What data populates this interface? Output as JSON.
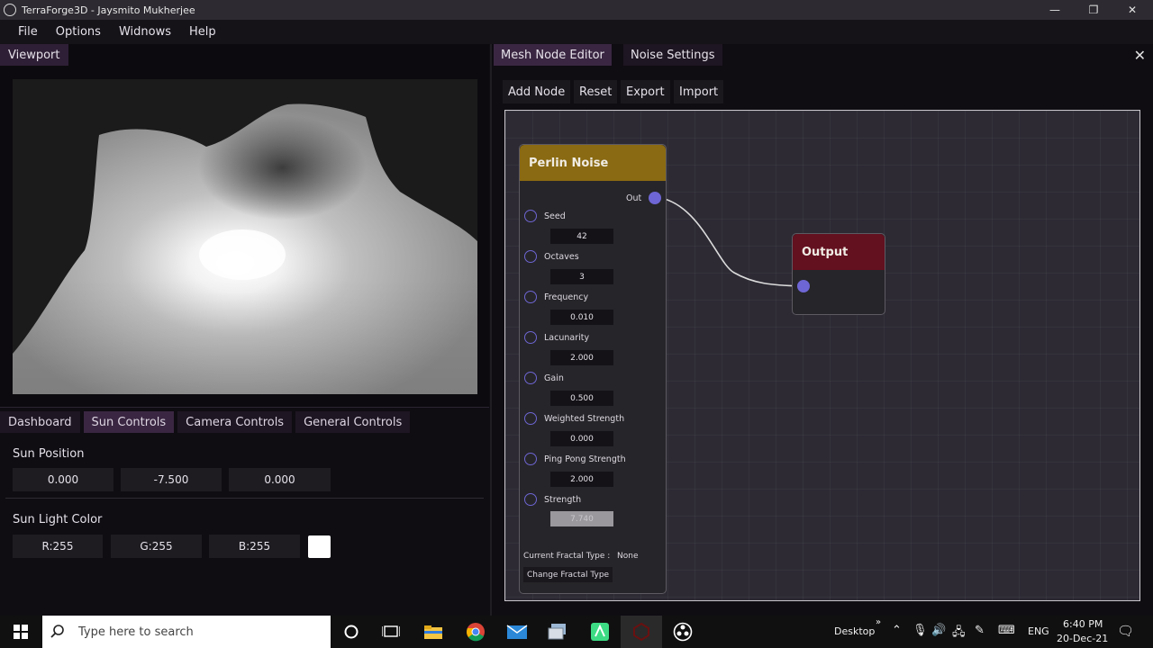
{
  "window": {
    "title": "TerraForge3D - Jaysmito Mukherjee"
  },
  "menu": [
    "File",
    "Options",
    "Widnows",
    "Help"
  ],
  "viewport": {
    "tab": "Viewport"
  },
  "controls": {
    "tabs": [
      "Dashboard",
      "Sun Controls",
      "Camera Controls",
      "General Controls"
    ],
    "sun_position": {
      "label": "Sun Position",
      "values": [
        "0.000",
        "-7.500",
        "0.000"
      ]
    },
    "sun_light_color": {
      "label": "Sun Light Color",
      "r": "R:255",
      "g": "G:255",
      "b": "B:255",
      "swatch": "#ffffff"
    }
  },
  "node_editor": {
    "tabs": [
      "Mesh Node Editor",
      "Noise Settings"
    ],
    "toolbar": [
      "Add Node",
      "Reset",
      "Export",
      "Import"
    ],
    "perlin_node": {
      "title": "Perlin Noise",
      "output_label": "Out",
      "params": [
        {
          "label": "Seed",
          "value": "42"
        },
        {
          "label": "Octaves",
          "value": "3"
        },
        {
          "label": "Frequency",
          "value": "0.010"
        },
        {
          "label": "Lacunarity",
          "value": "2.000"
        },
        {
          "label": "Gain",
          "value": "0.500"
        },
        {
          "label": "Weighted Strength",
          "value": "0.000"
        },
        {
          "label": "Ping Pong Strength",
          "value": "2.000"
        },
        {
          "label": "Strength",
          "value": "7.740"
        }
      ],
      "fractal_label": "Current Fractal Type :",
      "fractal_value": "None",
      "change_fractal": "Change Fractal Type"
    },
    "output_node": {
      "title": "Output"
    }
  },
  "taskbar": {
    "search_placeholder": "Type here to search",
    "desktop_label": "Desktop",
    "language": "ENG",
    "time": "6:40 PM",
    "date": "20-Dec-21"
  }
}
